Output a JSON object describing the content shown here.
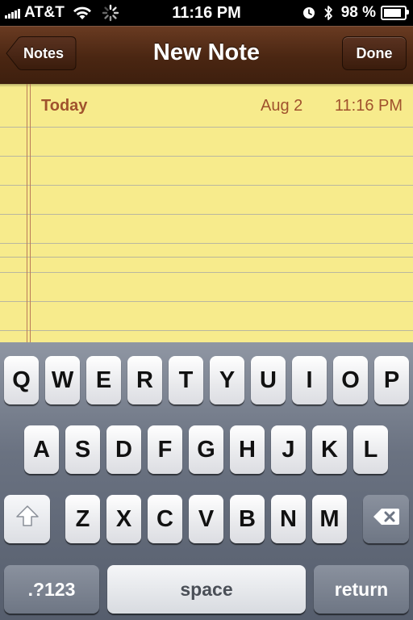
{
  "status_bar": {
    "carrier": "AT&T",
    "time": "11:16 PM",
    "battery_percent": "98 %",
    "battery_level": 0.98,
    "icons": [
      "signal-icon",
      "wifi-icon",
      "activity-spinner-icon",
      "alarm-icon",
      "bluetooth-icon",
      "battery-icon"
    ]
  },
  "nav": {
    "title": "New Note",
    "back_label": "Notes",
    "done_label": "Done"
  },
  "note": {
    "date_label": "Today",
    "date": "Aug 2",
    "time": "11:16 PM"
  },
  "keyboard": {
    "row1": [
      "Q",
      "W",
      "E",
      "R",
      "T",
      "Y",
      "U",
      "I",
      "O",
      "P"
    ],
    "row2": [
      "A",
      "S",
      "D",
      "F",
      "G",
      "H",
      "J",
      "K",
      "L"
    ],
    "row3": [
      "Z",
      "X",
      "C",
      "V",
      "B",
      "N",
      "M"
    ],
    "numbers_label": ".?123",
    "space_label": "space",
    "return_label": "return",
    "icons": [
      "shift-icon",
      "backspace-icon"
    ]
  },
  "colors": {
    "nav_brown": "#4a2612",
    "paper_yellow": "#f7eb8c",
    "date_text": "#a0522d",
    "keyboard_bg": "#6a7281"
  }
}
